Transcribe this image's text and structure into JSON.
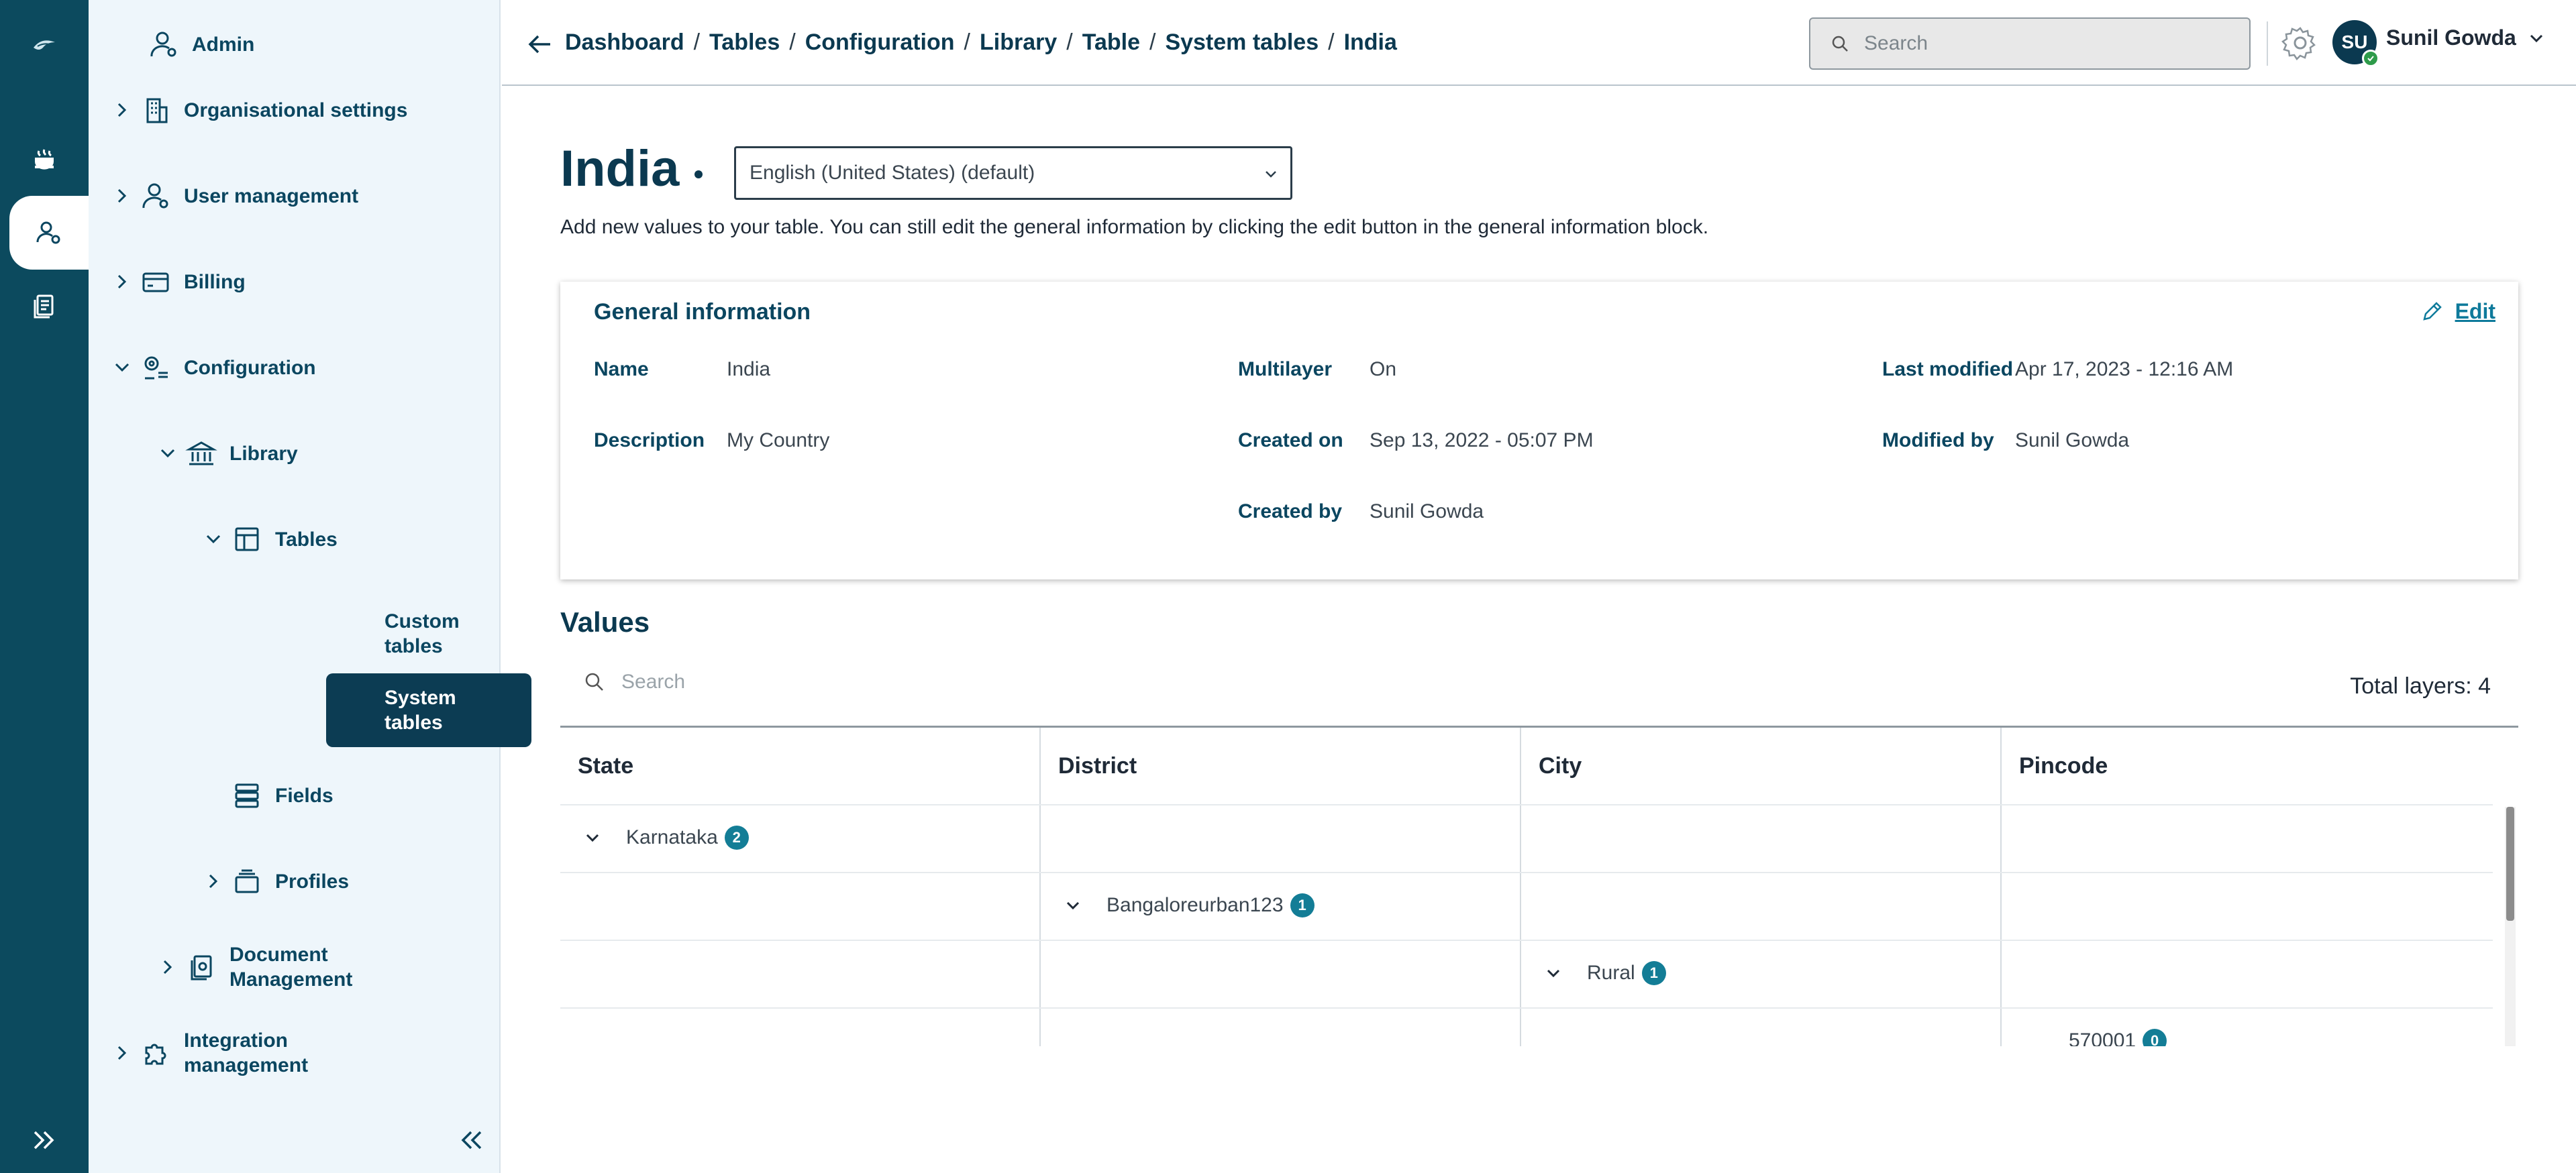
{
  "header": {
    "breadcrumbs": [
      "Dashboard",
      "Tables",
      "Configuration",
      "Library",
      "Table",
      "System tables",
      "India"
    ],
    "search_placeholder": "Search",
    "user": {
      "initials": "SU",
      "name": "Sunil Gowda"
    }
  },
  "sidebar": {
    "admin": "Admin",
    "items": {
      "organisational_settings": "Organisational settings",
      "user_management": "User management",
      "billing": "Billing",
      "configuration": "Configuration",
      "library": "Library",
      "tables": "Tables",
      "custom_tables_1": "Custom",
      "custom_tables_2": "tables",
      "system_tables_1": "System",
      "system_tables_2": "tables",
      "fields": "Fields",
      "profiles": "Profiles",
      "document_management_1": "Document",
      "document_management_2": "Management",
      "integration_management_1": "Integration",
      "integration_management_2": "management"
    }
  },
  "page": {
    "title": "India",
    "language": "English (United States) (default)",
    "description": "Add new values to your table. You can still edit the general information by clicking the edit button in the general information block."
  },
  "general_info": {
    "title": "General information",
    "edit_label": "Edit",
    "fields": {
      "name_label": "Name",
      "name_value": "India",
      "description_label": "Description",
      "description_value": "My Country",
      "multilayer_label": "Multilayer",
      "multilayer_value": "On",
      "created_on_label": "Created on",
      "created_on_value": "Sep 13, 2022 - 05:07 PM",
      "created_by_label": "Created by",
      "created_by_value": "Sunil Gowda",
      "last_modified_label": "Last modified",
      "last_modified_value": "Apr 17, 2023 - 12:16 AM",
      "modified_by_label": "Modified by",
      "modified_by_value": "Sunil Gowda"
    }
  },
  "values": {
    "title": "Values",
    "search_placeholder": "Search",
    "total_layers": "Total layers: 4",
    "columns": [
      "State",
      "District",
      "City",
      "Pincode"
    ],
    "rows": [
      {
        "label": "Karnataka",
        "count": "2"
      },
      {
        "label": "Bangaloreurban123",
        "count": "1"
      },
      {
        "label": "Rural",
        "count": "1"
      },
      {
        "label": "570001",
        "count": "0"
      }
    ]
  },
  "colors": {
    "rail": "#0c4a5e",
    "sidebar": "#eef6fb",
    "accent": "#137d96",
    "dark": "#0b3950"
  }
}
